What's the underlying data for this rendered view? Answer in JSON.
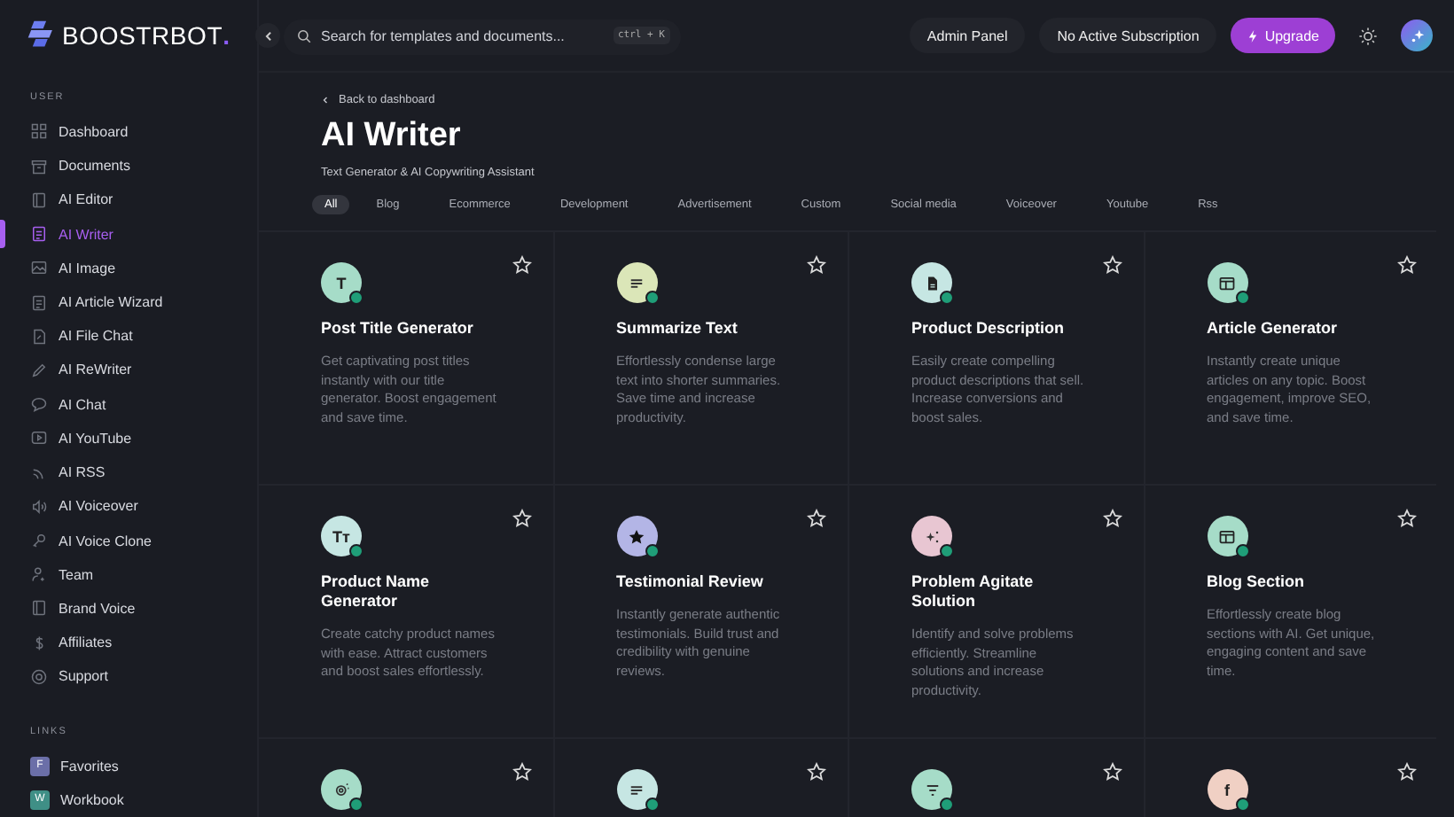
{
  "brand": {
    "name": "BOOSTRBOT",
    "dot": "."
  },
  "sidebar": {
    "sections": [
      {
        "heading": "USER",
        "items": [
          {
            "label": "Dashboard",
            "selected": false
          },
          {
            "label": "Documents",
            "selected": false
          },
          {
            "label": "AI Editor",
            "selected": false
          },
          {
            "label": "AI Writer",
            "selected": true
          },
          {
            "label": "AI Image",
            "selected": false
          },
          {
            "label": "AI Article Wizard",
            "selected": false
          },
          {
            "label": "AI File Chat",
            "selected": false
          },
          {
            "label": "AI ReWriter",
            "selected": false
          },
          {
            "label": "AI Chat",
            "selected": false
          },
          {
            "label": "AI YouTube",
            "selected": false
          },
          {
            "label": "AI RSS",
            "selected": false
          },
          {
            "label": "AI Voiceover",
            "selected": false
          },
          {
            "label": "AI Voice Clone",
            "selected": false
          },
          {
            "label": "Team",
            "selected": false
          },
          {
            "label": "Brand Voice",
            "selected": false
          },
          {
            "label": "Affiliates",
            "selected": false
          },
          {
            "label": "Support",
            "selected": false
          }
        ]
      },
      {
        "heading": "LINKS",
        "items": [
          {
            "label": "Favorites",
            "badge": "F",
            "color": "#6b6fa8",
            "selected": false
          },
          {
            "label": "Workbook",
            "badge": "W",
            "color": "#3f8f86",
            "selected": false
          }
        ]
      }
    ]
  },
  "topbar": {
    "search": {
      "placeholder": "Search for templates and documents...",
      "shortcut": "ctrl + K"
    },
    "buttons": [
      "Admin Panel",
      "No Active Subscription"
    ],
    "upgrade": "Upgrade"
  },
  "header": {
    "back": "Back to dashboard",
    "title": "AI Writer",
    "subtitle": "Text Generator & AI Copywriting Assistant"
  },
  "filters": [
    {
      "label": "All",
      "selected": true
    },
    {
      "label": "Blog",
      "selected": false
    },
    {
      "label": "Ecommerce",
      "selected": false
    },
    {
      "label": "Development",
      "selected": false
    },
    {
      "label": "Advertisement",
      "selected": false
    },
    {
      "label": "Custom",
      "selected": false
    },
    {
      "label": "Social media",
      "selected": false
    },
    {
      "label": "Voiceover",
      "selected": false
    },
    {
      "label": "Youtube",
      "selected": false
    },
    {
      "label": "Rss",
      "selected": false
    }
  ],
  "cards": [
    {
      "icon": {
        "kind": "letter",
        "text": "T"
      },
      "color": "#a6dcc8",
      "title": "Post Title Generator",
      "description": "Get captivating post titles instantly with our title generator. Boost engagement and save time."
    },
    {
      "icon": {
        "kind": "lines"
      },
      "color": "#dbe6b8",
      "title": "Summarize Text",
      "description": "Effortlessly condense large text into shorter summaries. Save time and increase productivity."
    },
    {
      "icon": {
        "kind": "doc"
      },
      "color": "#c6e6e3",
      "title": "Product Description",
      "description": "Easily create compelling product descriptions that sell. Increase conversions and boost sales."
    },
    {
      "icon": {
        "kind": "layout"
      },
      "color": "#a6dcc8",
      "title": "Article Generator",
      "description": "Instantly create unique articles on any topic. Boost engagement, improve SEO, and save time."
    },
    {
      "icon": {
        "kind": "letter",
        "text": "Tт"
      },
      "color": "#c6e6e3",
      "title": "Product Name Generator",
      "description": "Create catchy product names with ease. Attract customers and boost sales effortlessly."
    },
    {
      "icon": {
        "kind": "star"
      },
      "color": "#b3b5e6",
      "title": "Testimonial Review",
      "description": "Instantly generate authentic testimonials. Build trust and credibility with genuine reviews."
    },
    {
      "icon": {
        "kind": "sparkle"
      },
      "color": "#e8c6d2",
      "title": "Problem Agitate Solution",
      "description": "Identify and solve problems efficiently. Streamline solutions and increase productivity."
    },
    {
      "icon": {
        "kind": "layout"
      },
      "color": "#a6dcc8",
      "title": "Blog Section",
      "description": "Effortlessly create blog sections with AI. Get unique, engaging content and save time."
    },
    {
      "icon": {
        "kind": "gear"
      },
      "color": "#a6dcc8"
    },
    {
      "icon": {
        "kind": "lines"
      },
      "color": "#c6e6e3"
    },
    {
      "icon": {
        "kind": "filter"
      },
      "color": "#a6dcc8"
    },
    {
      "icon": {
        "kind": "letter",
        "text": "f"
      },
      "color": "#f0d0c4"
    }
  ]
}
